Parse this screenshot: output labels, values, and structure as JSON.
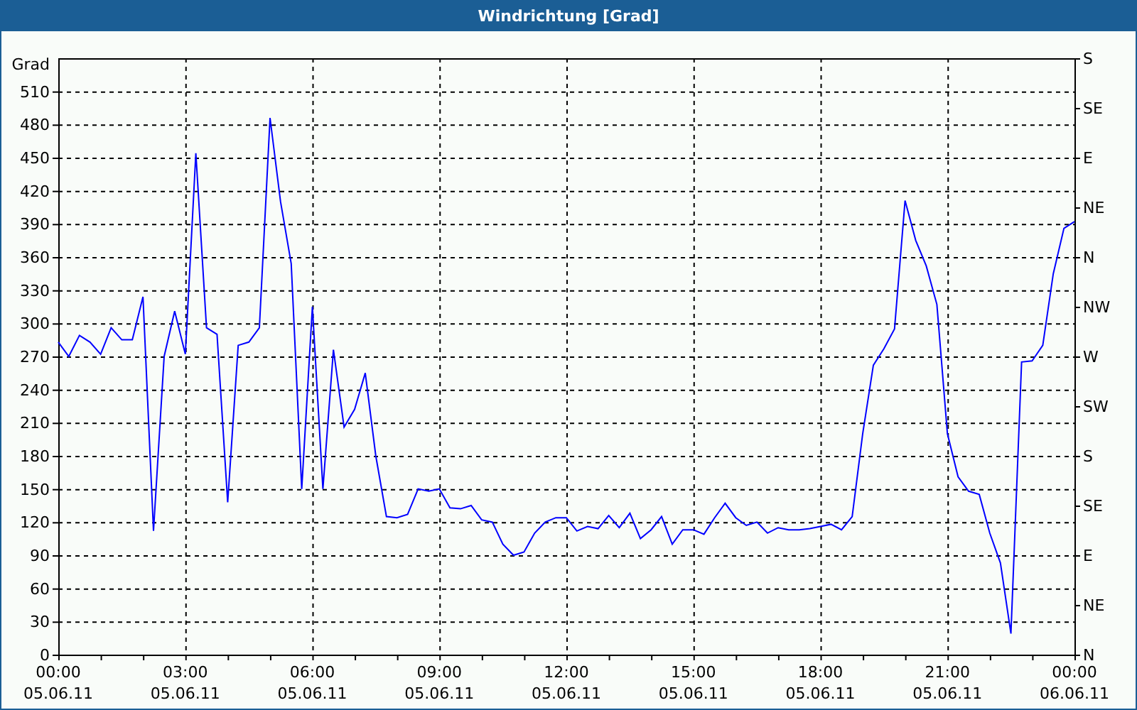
{
  "window": {
    "title": "Windrichtung [Grad]"
  },
  "chart": {
    "chart_data": {
      "type": "line",
      "grid": true,
      "ylabel": "Grad",
      "ylim": [
        0,
        540
      ],
      "yticks": [
        0,
        30,
        60,
        90,
        120,
        150,
        180,
        210,
        240,
        270,
        300,
        330,
        360,
        390,
        420,
        450,
        480,
        510
      ],
      "categories": [
        "00:00 05.06.11",
        null,
        null,
        null,
        null,
        null,
        null,
        null,
        null,
        null,
        null,
        null,
        "03:00 05.06.11",
        null,
        null,
        null,
        null,
        null,
        null,
        null,
        null,
        null,
        null,
        null,
        "06:00 05.06.11",
        null,
        null,
        null,
        null,
        null,
        null,
        null,
        null,
        null,
        null,
        null,
        "09:00 05.06.11",
        null,
        null,
        null,
        null,
        null,
        null,
        null,
        null,
        null,
        null,
        null,
        "12:00 05.06.11",
        null,
        null,
        null,
        null,
        null,
        null,
        null,
        null,
        null,
        null,
        null,
        "15:00 05.06.11",
        null,
        null,
        null,
        null,
        null,
        null,
        null,
        null,
        null,
        null,
        null,
        "18:00 05.06.11",
        null,
        null,
        null,
        null,
        null,
        null,
        null,
        null,
        null,
        null,
        null,
        "21:00 05.06.11",
        null,
        null,
        null,
        null,
        null,
        null,
        null,
        null,
        null,
        null,
        null,
        "00:00 06.06.11"
      ],
      "series": [
        {
          "color": "#0000ff",
          "values": [
            283,
            270,
            289,
            283,
            272,
            296,
            285,
            285,
            324,
            112,
            270,
            311,
            272,
            454,
            296,
            290,
            138,
            280,
            283,
            296,
            486,
            410,
            354,
            150,
            315,
            150,
            276,
            206,
            222,
            255,
            180,
            125,
            124,
            127,
            150,
            148,
            150,
            133,
            132,
            135,
            122,
            120,
            100,
            90,
            93,
            110,
            120,
            124,
            124,
            112,
            116,
            114,
            126,
            115,
            128,
            105,
            113,
            125,
            100,
            113,
            113,
            109,
            124,
            137,
            124,
            117,
            120,
            110,
            115,
            113,
            113,
            114,
            116,
            118,
            113,
            125,
            200,
            262,
            277,
            295,
            411,
            375,
            352,
            317,
            200,
            161,
            148,
            145,
            110,
            83,
            19,
            265,
            266,
            280,
            345,
            386,
            392
          ]
        }
      ]
    },
    "direction_labels": [
      "S",
      "SE",
      "E",
      "NE",
      "N",
      "NW",
      "W",
      "SW",
      "S",
      "SE",
      "E",
      "NE",
      "N"
    ]
  }
}
